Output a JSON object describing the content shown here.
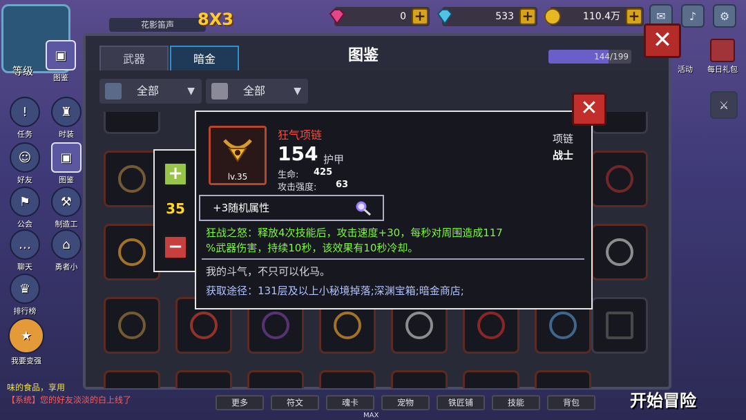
{
  "player": {
    "level_label": "等级",
    "name": "花影笛声",
    "vip": "8X3"
  },
  "currency": [
    {
      "icon": "pink-gem-icon",
      "value": "0"
    },
    {
      "icon": "blue-diamond-icon",
      "value": "533"
    },
    {
      "icon": "gold-coin-icon",
      "value": "110.4万"
    }
  ],
  "sidebar": [
    {
      "label": "图鉴",
      "icon": "codex-icon"
    },
    {
      "label": "任务",
      "icon": "quest-icon"
    },
    {
      "label": "时装",
      "icon": "costume-icon"
    },
    {
      "label": "好友",
      "icon": "friend-icon"
    },
    {
      "label": "图鉴",
      "icon": "codex-small-icon"
    },
    {
      "label": "公会",
      "icon": "guild-icon"
    },
    {
      "label": "制造工",
      "icon": "craft-icon"
    },
    {
      "label": "聊天",
      "icon": "chat-icon"
    },
    {
      "label": "勇者小",
      "icon": "hero-icon"
    },
    {
      "label": "排行榜",
      "icon": "trophy-icon"
    },
    {
      "label": "我要变强",
      "icon": "powerup-icon"
    }
  ],
  "right": [
    {
      "label": "活动",
      "icon": "event-icon"
    },
    {
      "label": "每日礼包",
      "icon": "gift-icon"
    }
  ],
  "panel": {
    "title": "图鉴",
    "tabs": [
      "武器",
      "暗金"
    ],
    "active_tab": 1,
    "progress_text": "144/199",
    "progress_fraction": 0.7236,
    "filters": [
      {
        "label": "全部",
        "icon": "grid-icon"
      },
      {
        "label": "全部",
        "icon": "class-icon"
      }
    ]
  },
  "quantity": {
    "value": "35"
  },
  "tooltip": {
    "name": "狂气项链",
    "level": "lv.35",
    "armor_value": "154",
    "armor_label": "护甲",
    "stats": [
      {
        "label": "生命:",
        "value": "425"
      },
      {
        "label": "攻击强度:",
        "value": "63"
      }
    ],
    "slot_type": "项链",
    "class": "战士",
    "random_attr": "+3随机属性",
    "effect_line1": "狂战之怒：释放4次技能后，攻击速度+30，每秒对周围造成117",
    "effect_line2": "%武器伤害，持续10秒，该效果有10秒冷却。",
    "flavor": "我的斗气，不只可以化马。",
    "source": "获取途径：131层及以上小秘境掉落;深渊宝箱;暗金商店;"
  },
  "chat": [
    {
      "text": "味的食品，享用",
      "color": "#e9e24a"
    },
    {
      "text": "【系统】您的好友淡淡的白上线了",
      "color": "#ff5b5b"
    }
  ],
  "bottom_bar": [
    "更多",
    "符文",
    "魂卡",
    "宠物",
    "铁匠铺",
    "技能",
    "背包"
  ],
  "start_button": "开始冒险",
  "max_label": "MAX",
  "close_glyph": "✕"
}
